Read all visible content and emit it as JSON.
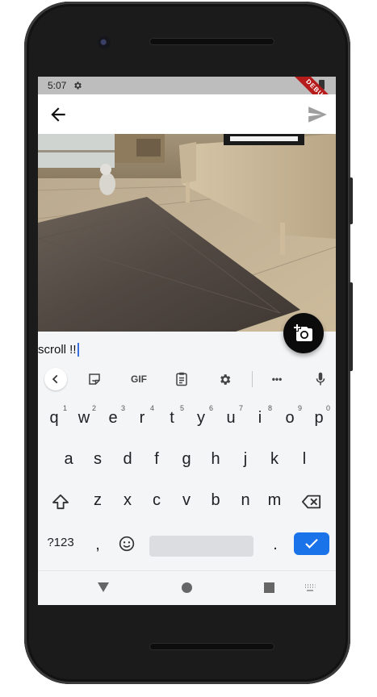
{
  "status_bar": {
    "time": "5:07",
    "debug_label": "DEBUG"
  },
  "app_bar": {
    "back_icon": "arrow-back-icon",
    "send_icon": "send-icon"
  },
  "photo": {
    "description_icon": "photo-image"
  },
  "fab": {
    "icon": "add-a-photo-icon"
  },
  "text_input": {
    "value": "scroll !!"
  },
  "keyboard": {
    "toolbar": {
      "items": [
        "chevron-left-icon",
        "sticker-icon",
        "GIF",
        "clipboard-icon",
        "gear-icon",
        "more-icon",
        "mic-icon"
      ],
      "gif_label": "GIF",
      "more_label": "•••"
    },
    "row1": [
      "q",
      "w",
      "e",
      "r",
      "t",
      "y",
      "u",
      "i",
      "o",
      "p"
    ],
    "row1_hints": [
      "1",
      "2",
      "3",
      "4",
      "5",
      "6",
      "7",
      "8",
      "9",
      "0"
    ],
    "row2": [
      "a",
      "s",
      "d",
      "f",
      "g",
      "h",
      "j",
      "k",
      "l"
    ],
    "row3": [
      "z",
      "x",
      "c",
      "v",
      "b",
      "n",
      "m"
    ],
    "bottom": {
      "symbols": "?123",
      "comma": ",",
      "period": ".",
      "emoji_icon": "emoji-icon",
      "enter_icon": "check-icon"
    }
  },
  "colors": {
    "accent": "#1a73e8",
    "fab_bg": "#0b0b0b",
    "debug": "#b71c1c"
  }
}
